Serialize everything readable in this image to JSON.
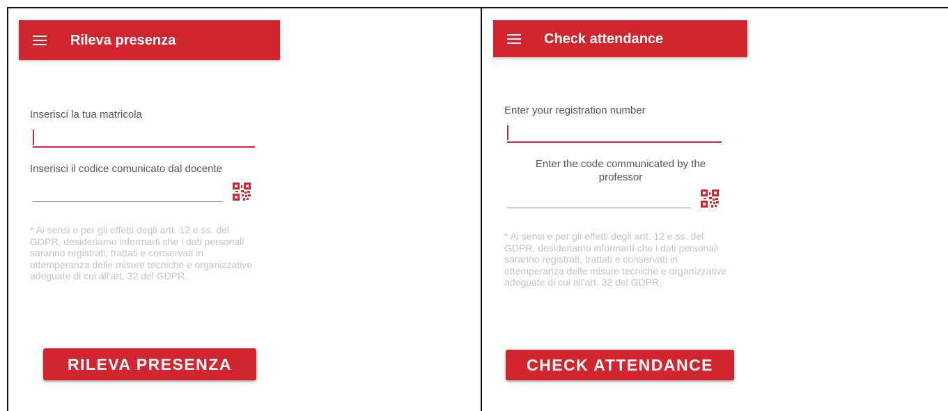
{
  "left_panel": {
    "title": "Rileva presenza",
    "registration_label": "Inserisci la tua matricola",
    "registration_value": "",
    "code_label": "Inserisci il codice comunicato dal docente",
    "code_value": "",
    "disclaimer": "* Ai sensi e per gli effetti degli artt. 12 e ss. del GDPR, desideriamo informarti che i dati personali saranno registrati, trattati e conservati in ottemperanza delle misure tecniche e organizzative adeguate di cui all'art. 32 del GDPR.",
    "button_label": "RILEVA PRESENZA"
  },
  "right_panel": {
    "title": "Check attendance",
    "registration_label": "Enter your registration number",
    "registration_value": "",
    "code_label": "Enter the code communicated by the professor",
    "code_value": "",
    "disclaimer": "* Ai sensi e per gli effetti degli artt. 12 e ss. del GDPR, desideriamo informarti che i dati personali saranno registrati, trattati e conservati in ottemperanza delle misure tecniche e organizzative adeguate di cui all'art. 32 del GDPR.",
    "button_label": "CHECK ATTENDANCE"
  },
  "theme": {
    "accent": "#d1252f",
    "disclaimer_text": "#c4c4c4"
  },
  "icons": {
    "menu": "hamburger-menu-icon",
    "qr": "qr-code-icon"
  }
}
